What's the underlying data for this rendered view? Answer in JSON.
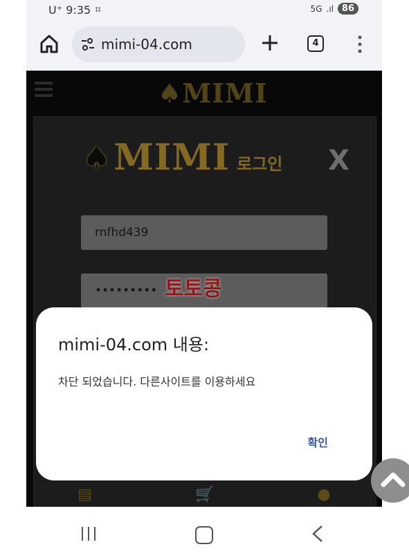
{
  "status": {
    "carrier_time": "U⁺ 9:35",
    "network": "5G",
    "battery": "86"
  },
  "browser": {
    "url": "mimi-04.com",
    "tab_count": "4"
  },
  "page": {
    "top_logo": "♠MIMI",
    "modal": {
      "brand": "MIMI",
      "login_label": "로그인",
      "close_label": "X",
      "username_value": "rnfhd439",
      "password_value": "•••••••••"
    },
    "watermark": "토토콩"
  },
  "dialog": {
    "title": "mimi-04.com 내용:",
    "message": "차단 되었습니다. 다른사이트를 이용하세요",
    "ok_label": "확인"
  },
  "colors": {
    "accent_gold": "#c9a234",
    "dialog_button": "#3a5aa8",
    "watermark_red": "#e32222"
  }
}
